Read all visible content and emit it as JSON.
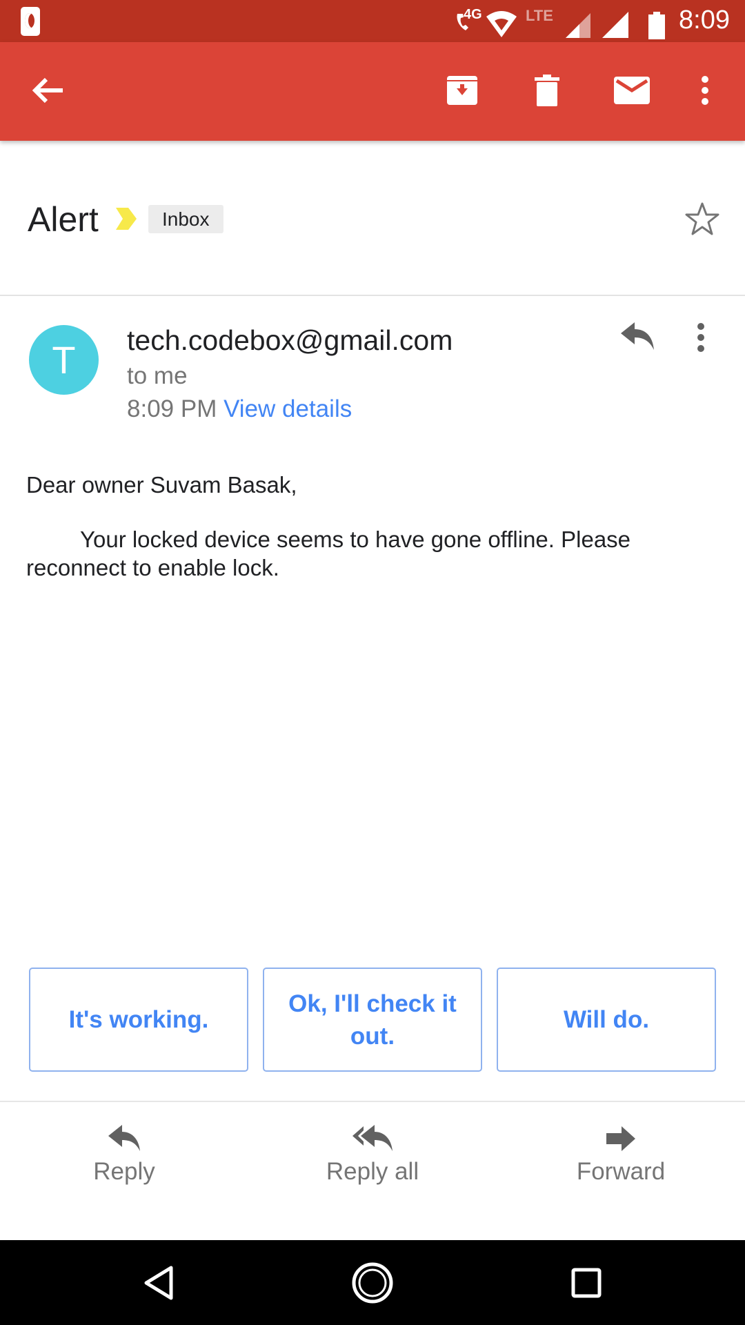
{
  "status_bar": {
    "time": "8:09",
    "network_4g": "4G",
    "network_lte": "LTE"
  },
  "app_bar": {
    "back_icon": "arrow-back-icon",
    "actions": [
      "archive-icon",
      "delete-icon",
      "mark-unread-icon",
      "more-vert-icon"
    ],
    "color": "#db4437"
  },
  "message": {
    "subject": "Alert",
    "label": "Inbox",
    "sender": "tech.codebox@gmail.com",
    "avatar_letter": "T",
    "avatar_color": "#4dd0e1",
    "recipient": "to me",
    "time": "8:09 PM",
    "view_details": "View details",
    "greeting": "Dear owner Suvam Basak,",
    "body": "Your locked device seems to have gone offline. Please reconnect to enable lock."
  },
  "smart_replies": [
    "It's working.",
    "Ok, I'll check it out.",
    "Will do."
  ],
  "actions": {
    "reply": "Reply",
    "reply_all": "Reply all",
    "forward": "Forward"
  },
  "accent_color": "#4285f4"
}
